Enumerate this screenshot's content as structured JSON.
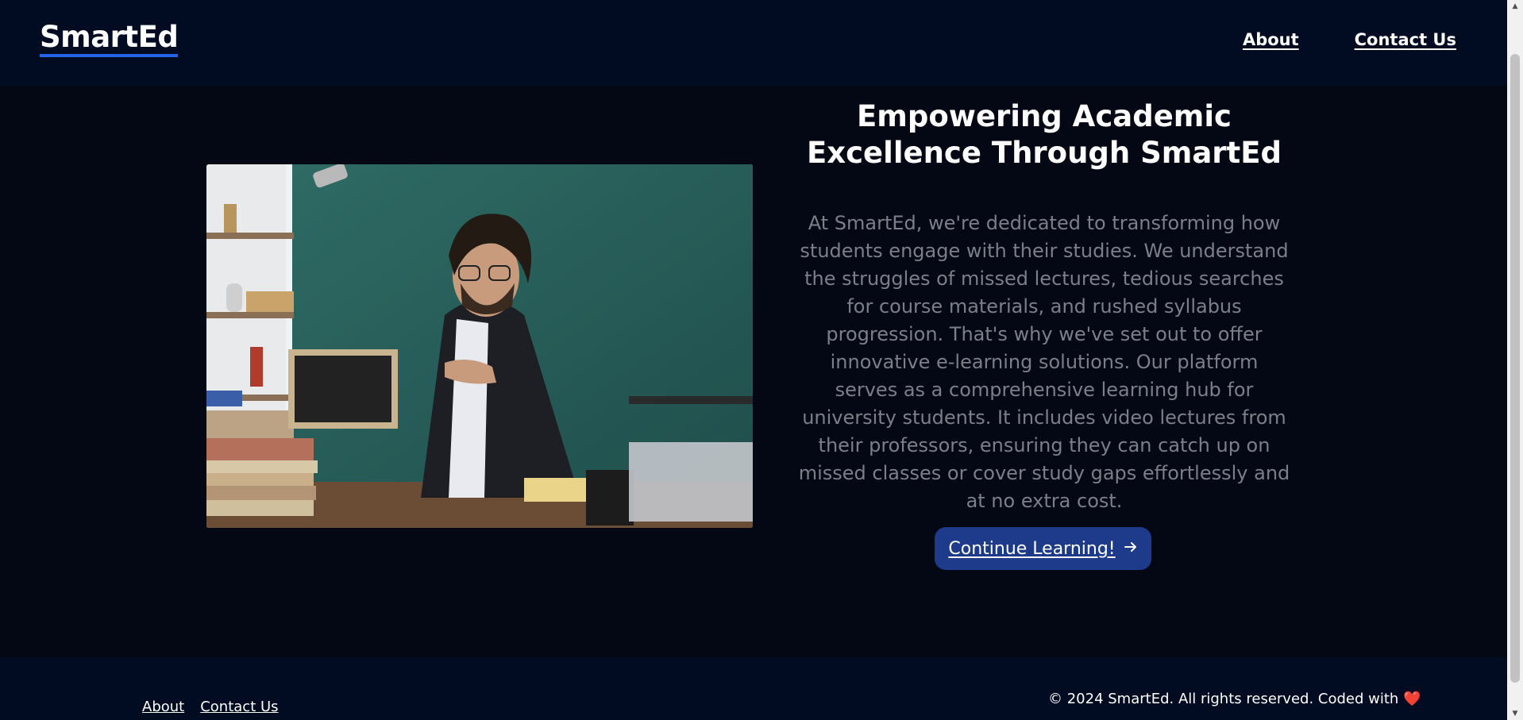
{
  "header": {
    "logo": "SmartEd",
    "nav": [
      {
        "label": "About"
      },
      {
        "label": "Contact Us"
      }
    ]
  },
  "hero": {
    "title": "Empowering Academic Excellence Through SmartEd",
    "description": "At SmartEd, we're dedicated to transforming how students engage with their studies. We understand the struggles of missed lectures, tedious searches for course materials, and rushed syllabus progression. That's why we've set out to offer innovative e-learning solutions. Our platform serves as a comprehensive learning hub for university students. It includes video lectures from their professors, ensuring they can catch up on missed classes or cover study gaps effortlessly and at no extra cost.",
    "cta_label": "Continue Learning!",
    "cta_icon": "arrow-right-icon",
    "image_alt": "teacher-pointing-at-small-chalkboard"
  },
  "footer": {
    "links": [
      {
        "label": "About"
      },
      {
        "label": "Contact Us"
      }
    ],
    "copyright": "© 2024 SmartEd. All rights reserved. Coded with",
    "heart_icon": "heart-icon"
  },
  "colors": {
    "header_bg": "#010b21",
    "page_bg": "#030814",
    "accent": "#2563eb",
    "button_bg": "#1e3a8a",
    "body_text": "#7b7f89",
    "heart": "#e11d48"
  }
}
